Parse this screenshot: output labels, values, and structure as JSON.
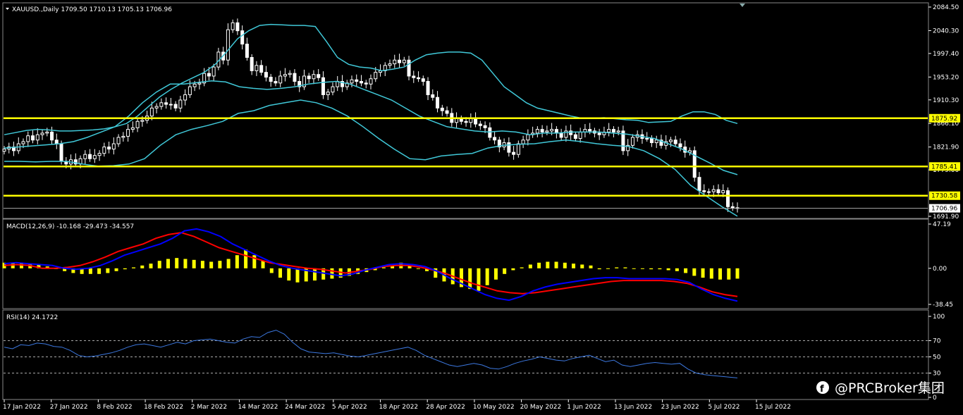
{
  "symbol_header": "XAUUSD.,Daily  1709.50 1710.13 1705.13 1706.96",
  "macd_header": "MACD(12,26,9) -10.168 -29.473 -34.557",
  "rsi_header": "RSI(14) 24.1722",
  "watermark": "@PRCBroker集团",
  "colors": {
    "candle": "#ffffff",
    "bollinger": "#40c8d8",
    "level": "#ffff00",
    "macd_hist": "#ffff00",
    "macd_line": "#0000ff",
    "macd_signal": "#ff0000",
    "rsi_line": "#3c78e0"
  },
  "price_axis": [
    "2084.50",
    "2040.30",
    "1997.40",
    "1953.20",
    "1910.30",
    "1866.10",
    "1821.90",
    "1779.00",
    "1691.90"
  ],
  "price_tags": [
    {
      "value": "1875.92",
      "style": "level"
    },
    {
      "value": "1785.41",
      "style": "level"
    },
    {
      "value": "1730.58",
      "style": "level"
    },
    {
      "value": "1706.96",
      "style": "current"
    }
  ],
  "macd_axis": [
    "47.19",
    "0.00",
    "-38.45"
  ],
  "rsi_axis": [
    "100",
    "70",
    "50",
    "30",
    "0"
  ],
  "time_axis": [
    "17 Jan 2022",
    "27 Jan 2022",
    "8 Feb 2022",
    "18 Feb 2022",
    "2 Mar 2022",
    "14 Mar 2022",
    "24 Mar 2022",
    "5 Apr 2022",
    "18 Apr 2022",
    "28 Apr 2022",
    "10 May 2022",
    "20 May 2022",
    "1 Jun 2022",
    "13 Jun 2022",
    "23 Jun 2022",
    "5 Jul 2022",
    "15 Jul 2022"
  ],
  "chart_data": {
    "type": "candlestick",
    "instrument": "XAUUSD.",
    "timeframe": "Daily",
    "ylim": [
      1691.9,
      2084.5
    ],
    "ohlc_last": {
      "open": 1709.5,
      "high": 1710.13,
      "low": 1705.13,
      "close": 1706.96
    },
    "horizontal_levels": [
      1875.92,
      1785.41,
      1730.58
    ],
    "close": [
      1818,
      1822,
      1815,
      1828,
      1832,
      1843,
      1835,
      1845,
      1848,
      1850,
      1835,
      1828,
      1795,
      1790,
      1798,
      1790,
      1800,
      1808,
      1800,
      1806,
      1810,
      1822,
      1818,
      1828,
      1840,
      1842,
      1855,
      1858,
      1870,
      1872,
      1880,
      1895,
      1898,
      1905,
      1902,
      1902,
      1895,
      1910,
      1920,
      1935,
      1940,
      1942,
      1960,
      1955,
      1972,
      2000,
      1985,
      2042,
      2055,
      2040,
      2015,
      1990,
      1965,
      1975,
      1962,
      1953,
      1945,
      1942,
      1955,
      1958,
      1960,
      1945,
      1935,
      1955,
      1950,
      1958,
      1952,
      1920,
      1925,
      1935,
      1945,
      1935,
      1942,
      1948,
      1945,
      1942,
      1940,
      1950,
      1962,
      1965,
      1975,
      1978,
      1985,
      1980,
      1985,
      1955,
      1952,
      1950,
      1945,
      1920,
      1915,
      1895,
      1890,
      1885,
      1868,
      1875,
      1870,
      1868,
      1875,
      1865,
      1862,
      1858,
      1840,
      1835,
      1822,
      1830,
      1812,
      1808,
      1828,
      1835,
      1845,
      1848,
      1855,
      1850,
      1852,
      1855,
      1848,
      1840,
      1852,
      1845,
      1838,
      1850,
      1855,
      1852,
      1848,
      1845,
      1850,
      1855,
      1850,
      1852,
      1815,
      1825,
      1840,
      1845,
      1838,
      1838,
      1830,
      1835,
      1825,
      1832,
      1835,
      1828,
      1822,
      1812,
      1815,
      1765,
      1740,
      1738,
      1738,
      1742,
      1736,
      1740,
      1710,
      1708,
      1707
    ],
    "bollinger": {
      "upper": [
        1845,
        1849,
        1853,
        1855,
        1854,
        1852,
        1852,
        1853,
        1854,
        1856,
        1860,
        1866,
        1880,
        1898,
        1916,
        1930,
        1942,
        1952,
        1962,
        1977,
        2000,
        2025,
        2040,
        2050,
        2052,
        2051,
        2050,
        2050,
        2048,
        2020,
        1990,
        1977,
        1972,
        1970,
        1965,
        1968,
        1972,
        1985,
        1995,
        1998,
        2000,
        2000,
        1998,
        1985,
        1960,
        1935,
        1920,
        1905,
        1895,
        1890,
        1885,
        1880,
        1876,
        1876,
        1877,
        1875,
        1873,
        1872,
        1868,
        1869,
        1870,
        1880,
        1888,
        1888,
        1883,
        1872,
        1866
      ],
      "middle": [
        1820,
        1822,
        1824,
        1826,
        1828,
        1832,
        1840,
        1850,
        1860,
        1880,
        1905,
        1925,
        1940,
        1940,
        1943,
        1946,
        1944,
        1935,
        1932,
        1930,
        1932,
        1935,
        1940,
        1943,
        1945,
        1940,
        1930,
        1920,
        1910,
        1895,
        1880,
        1870,
        1860,
        1856,
        1852,
        1850,
        1852,
        1850,
        1845,
        1848,
        1848,
        1850,
        1850,
        1850,
        1848,
        1846,
        1842,
        1838,
        1828,
        1818,
        1805,
        1792,
        1778,
        1770
      ],
      "lower": [
        1795,
        1795,
        1794,
        1795,
        1795,
        1790,
        1786,
        1787,
        1790,
        1800,
        1825,
        1845,
        1855,
        1862,
        1870,
        1885,
        1890,
        1900,
        1905,
        1910,
        1905,
        1895,
        1880,
        1860,
        1838,
        1818,
        1800,
        1798,
        1805,
        1808,
        1810,
        1820,
        1825,
        1827,
        1828,
        1832,
        1835,
        1832,
        1828,
        1825,
        1823,
        1815,
        1800,
        1780,
        1750,
        1730,
        1710,
        1692
      ]
    },
    "macd": {
      "histogram": [
        6,
        6,
        6,
        5,
        4,
        2,
        0,
        -3,
        -5,
        -6,
        -6,
        -6,
        -5,
        -3,
        -1,
        1,
        3,
        5,
        8,
        10,
        11,
        10,
        9,
        8,
        7,
        8,
        10,
        14,
        20,
        14,
        8,
        -5,
        -10,
        -13,
        -15,
        -14,
        -13,
        -12,
        -11,
        -10,
        -8,
        -6,
        -4,
        -2,
        1,
        3,
        6,
        3,
        0,
        -3,
        -10,
        -14,
        -17,
        -20,
        -22,
        -24,
        -18,
        -12,
        -6,
        -2,
        1,
        4,
        6,
        7,
        7,
        6,
        5,
        4,
        3,
        -1,
        0,
        1,
        1,
        0,
        0,
        -1,
        -1,
        -2,
        -3,
        -5,
        -8,
        -10,
        -11,
        -12,
        -12,
        -11
      ],
      "macd_line": [
        5,
        6,
        5,
        4,
        3,
        0,
        -1,
        0,
        3,
        8,
        14,
        18,
        22,
        26,
        32,
        40,
        42,
        39,
        34,
        26,
        20,
        14,
        8,
        3,
        0,
        -2,
        -4,
        -6,
        -8,
        -6,
        -2,
        1,
        4,
        5,
        4,
        2,
        -3,
        -10,
        -16,
        -22,
        -28,
        -32,
        -34,
        -30,
        -24,
        -20,
        -17,
        -15,
        -13,
        -11,
        -10,
        -10,
        -11,
        -11,
        -11,
        -11,
        -12,
        -15,
        -22,
        -28,
        -32,
        -35
      ],
      "signal_line": [
        3,
        4,
        3,
        0,
        0,
        1,
        3,
        7,
        12,
        18,
        22,
        26,
        32,
        36,
        38,
        34,
        28,
        22,
        18,
        14,
        10,
        6,
        4,
        2,
        0,
        -1,
        -3,
        -5,
        -3,
        -1,
        2,
        3,
        3,
        1,
        -2,
        -6,
        -11,
        -16,
        -20,
        -24,
        -26,
        -27,
        -26,
        -24,
        -22,
        -20,
        -18,
        -16,
        -14,
        -13,
        -13,
        -13,
        -13,
        -14,
        -16,
        -20,
        -25,
        -28,
        -30
      ]
    },
    "rsi": {
      "period": 14,
      "current": 24.1722,
      "levels": [
        70,
        50,
        30
      ],
      "values": [
        62,
        60,
        65,
        64,
        67,
        66,
        63,
        62,
        58,
        52,
        50,
        51,
        53,
        55,
        58,
        62,
        65,
        66,
        64,
        62,
        65,
        68,
        66,
        70,
        71,
        72,
        70,
        68,
        67,
        72,
        75,
        74,
        80,
        83,
        78,
        68,
        60,
        56,
        55,
        54,
        55,
        53,
        51,
        50,
        52,
        54,
        56,
        58,
        60,
        62,
        58,
        52,
        48,
        44,
        40,
        38,
        40,
        42,
        40,
        36,
        35,
        38,
        42,
        45,
        47,
        50,
        48,
        46,
        45,
        48,
        50,
        52,
        48,
        44,
        46,
        40,
        38,
        40,
        42,
        43,
        42,
        41,
        42,
        35,
        30,
        28,
        27,
        26,
        25,
        24
      ]
    }
  }
}
